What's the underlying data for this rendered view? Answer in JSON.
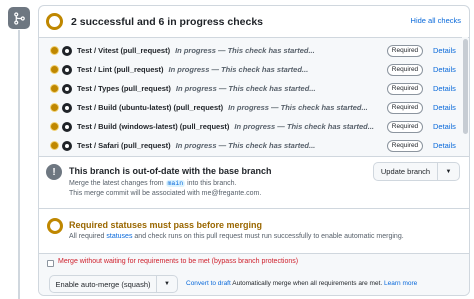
{
  "checks": {
    "title": "2 successful and 6 in progress checks",
    "hide_label": "Hide all checks",
    "items": [
      {
        "name": "Test / Vitest (pull_request)",
        "status": "In progress — This check has started...",
        "badge": "Required",
        "details": "Details"
      },
      {
        "name": "Test / Lint (pull_request)",
        "status": "In progress — This check has started...",
        "badge": "Required",
        "details": "Details"
      },
      {
        "name": "Test / Types (pull_request)",
        "status": "In progress — This check has started...",
        "badge": "Required",
        "details": "Details"
      },
      {
        "name": "Test / Build (ubuntu-latest) (pull_request)",
        "status": "In progress — This check has started...",
        "badge": "Required",
        "details": "Details"
      },
      {
        "name": "Test / Build (windows-latest) (pull_request)",
        "status": "In progress — This check has started...",
        "badge": "Required",
        "details": "Details"
      },
      {
        "name": "Test / Safari (pull_request)",
        "status": "In progress — This check has started...",
        "badge": "Required",
        "details": "Details"
      }
    ]
  },
  "outdated": {
    "title": "This branch is out-of-date with the base branch",
    "line1_before": "Merge the latest changes from",
    "branch": "main",
    "line1_after": "into this branch.",
    "line2": "This merge commit will be associated with me@fregante.com.",
    "update_label": "Update branch"
  },
  "required": {
    "title": "Required statuses must pass before merging",
    "line_before": "All required",
    "link": "statuses",
    "line_after": "and check runs on this pull request must run successfully to enable automatic merging."
  },
  "merge": {
    "bypass_label": "Merge without waiting for requirements to be met (bypass branch protections)",
    "auto_label": "Enable auto-merge (squash)",
    "draft_link": "Convert to draft",
    "draft_text": "Automatically merge when all requirements are met.",
    "learn_more": "Learn more"
  },
  "colors": {
    "pending": "#bf8700",
    "link": "#0969da",
    "danger": "#cf222e"
  }
}
